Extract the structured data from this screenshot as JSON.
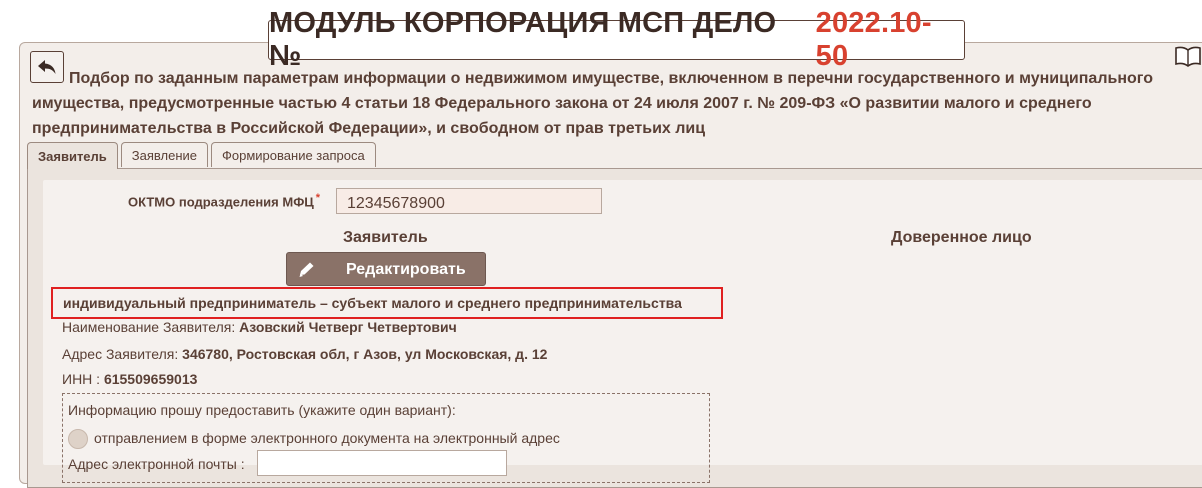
{
  "header": {
    "title_main": "МОДУЛЬ КОРПОРАЦИЯ МСП ДЕЛО №",
    "title_number": "2022.10-50",
    "description": "Подбор по заданным параметрам информации о недвижимом имуществе, включенном в перечни государственного и муниципального имущества, предусмотренные частью 4 статьи 18 Федерального закона от 24 июля 2007 г. № 209-ФЗ «О развитии малого и среднего предпринимательства в Российской Федерации», и свободном от прав третьих лиц"
  },
  "icons": {
    "back": "back-arrow-icon",
    "help": "open-book-icon",
    "edit": "pencil-icon"
  },
  "tabs": [
    {
      "label": "Заявитель",
      "active": true
    },
    {
      "label": "Заявление",
      "active": false
    },
    {
      "label": "Формирование запроса",
      "active": false
    }
  ],
  "form": {
    "oktmo_label": "ОКТМО подразделения МФЦ",
    "required_mark": "*",
    "oktmo_value": "12345678900",
    "applicant_heading": "Заявитель",
    "proxy_heading": "Доверенное лицо",
    "edit_button": "Редактировать",
    "applicant_type": "индивидуальный предприниматель – субъект малого и среднего предпринимательства",
    "name_label": "Наименование Заявителя:",
    "name_value": "Азовский Четверг Четвертович",
    "address_label": "Адрес Заявителя:",
    "address_value": "346780, Ростовская обл, г Азов, ул Московская, д. 12",
    "inn_label": "ИНН :",
    "inn_value": "615509659013",
    "delivery_prompt": "Информацию прошу предоставить (укажите один вариант):",
    "delivery_option_email": "отправлением в форме электронного документа на электронный адрес",
    "email_label": "Адрес электронной почты :",
    "email_value": ""
  },
  "colors": {
    "text": "#5a4036",
    "accent_red": "#d8412f",
    "highlight_border": "#e02020",
    "button_bg": "#8a7268",
    "panel_bg": "#ebe4de",
    "content_bg": "#f5f1ee"
  }
}
